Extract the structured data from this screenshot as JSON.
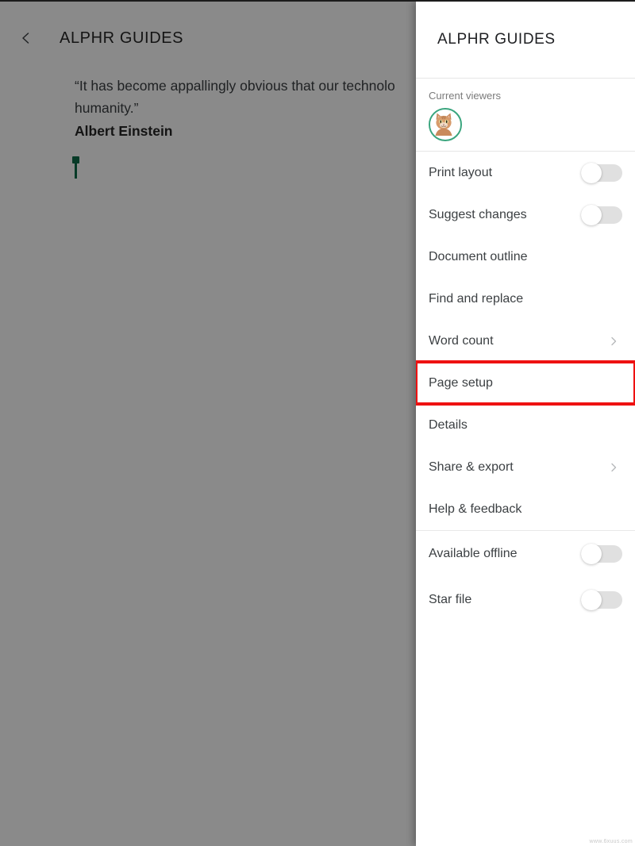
{
  "document": {
    "app_bar": {
      "back_icon": "chevron-left-icon",
      "title": "ALPHR GUIDES"
    },
    "body": {
      "quote_line_1": "“It has become appallingly obvious that our technolo",
      "quote_line_2": "humanity.”",
      "author": "Albert Einstein"
    }
  },
  "menu": {
    "title": "ALPHR GUIDES",
    "viewers": {
      "label": "Current viewers",
      "avatar_name": "cat-avatar",
      "avatar_ring_color": "#3aa57e"
    },
    "groups": [
      {
        "items": [
          {
            "label": "Print layout",
            "control": "toggle",
            "state": "off"
          },
          {
            "label": "Suggest changes",
            "control": "toggle",
            "state": "off"
          },
          {
            "label": "Document outline",
            "control": "none"
          },
          {
            "label": "Find and replace",
            "control": "none"
          },
          {
            "label": "Word count",
            "control": "chevron"
          },
          {
            "label": "Page setup",
            "control": "none",
            "highlighted": true
          },
          {
            "label": "Details",
            "control": "none"
          },
          {
            "label": "Share & export",
            "control": "chevron"
          },
          {
            "label": "Help & feedback",
            "control": "none"
          }
        ]
      },
      {
        "items": [
          {
            "label": "Available offline",
            "control": "toggle",
            "state": "off"
          },
          {
            "label": "Star file",
            "control": "toggle",
            "state": "off"
          }
        ]
      }
    ],
    "highlight_color": "#ee1111"
  },
  "watermark": "www.6xuus.com"
}
